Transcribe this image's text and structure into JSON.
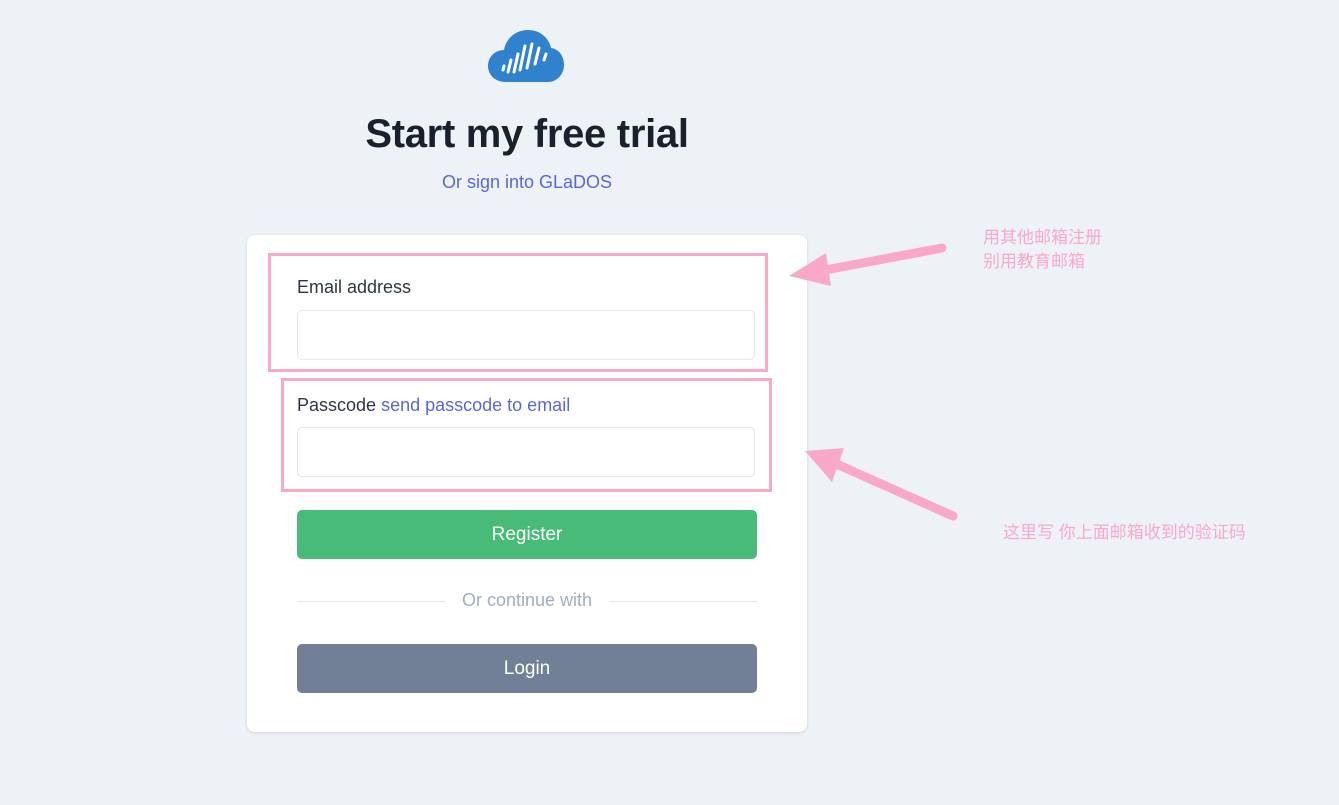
{
  "header": {
    "title": "Start my free trial",
    "subtitle_prefix": "Or",
    "signin_link": "sign into GLaDOS"
  },
  "form": {
    "email_label": "Email address",
    "email_value": "",
    "passcode_label": "Passcode",
    "send_passcode_link": "send passcode to email",
    "passcode_value": "",
    "register_button": "Register",
    "divider_text": "Or continue with",
    "login_button": "Login"
  },
  "annotations": {
    "note1_line1": "用其他邮箱注册",
    "note1_line2": "别用教育邮箱",
    "note2": "这里写 你上面邮箱收到的验证码",
    "color": "#f9a8c9"
  },
  "colors": {
    "background": "#edf2f7",
    "brand_blue": "#3182ce",
    "link": "#5a67d8",
    "register_green": "#48bb78",
    "login_gray": "#718096"
  }
}
